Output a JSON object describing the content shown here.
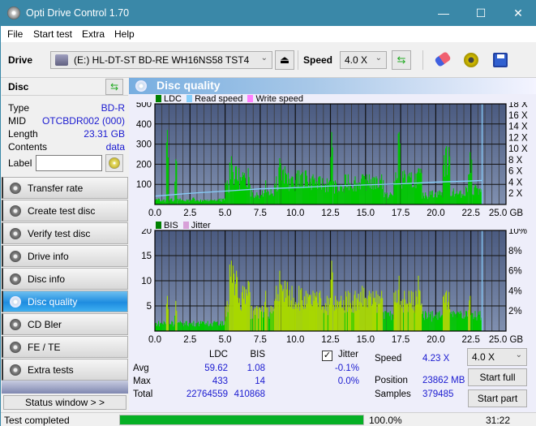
{
  "window": {
    "title": "Opti Drive Control 1.70",
    "minimize_glyph": "—",
    "maximize_glyph": "☐",
    "close_glyph": "✕"
  },
  "menu": [
    "File",
    "Start test",
    "Extra",
    "Help"
  ],
  "toolbar": {
    "drive_label": "Drive",
    "drive_value": "(E:)  HL-DT-ST BD-RE  WH16NS58 TST4",
    "speed_label": "Speed",
    "speed_value": "4.0 X",
    "icons": [
      "eject-icon",
      "refresh-icon",
      "erase-icon",
      "settings-icon",
      "save-icon"
    ]
  },
  "disc": {
    "heading": "Disc",
    "fields": [
      {
        "key": "Type",
        "value": "BD-R"
      },
      {
        "key": "MID",
        "value": "OTCBDR002 (000)"
      },
      {
        "key": "Length",
        "value": "23.31 GB"
      },
      {
        "key": "Contents",
        "value": "data"
      }
    ],
    "label_key": "Label",
    "label_value": ""
  },
  "nav": [
    {
      "label": "Transfer rate",
      "active": false
    },
    {
      "label": "Create test disc",
      "active": false
    },
    {
      "label": "Verify test disc",
      "active": false
    },
    {
      "label": "Drive info",
      "active": false
    },
    {
      "label": "Disc info",
      "active": false
    },
    {
      "label": "Disc quality",
      "active": true
    },
    {
      "label": "CD Bler",
      "active": false
    },
    {
      "label": "FE / TE",
      "active": false
    },
    {
      "label": "Extra tests",
      "active": false
    }
  ],
  "status_window_label": "Status window > >",
  "panel_title": "Disc quality",
  "colors": {
    "ldc": "#008000",
    "read_speed": "#87cefa",
    "write_speed": "#ff80ff",
    "bis": "#008000",
    "jitter": "#d8a0d8",
    "plot_bg_top": "#4a5a80",
    "plot_bg_bottom": "#8090b0",
    "bar_green": "#00c800",
    "bar_yellow": "#a8d800",
    "progress": "#06b025"
  },
  "chart_data": [
    {
      "type": "bar",
      "title": "LDC / Read speed",
      "legend": [
        "LDC",
        "Read speed",
        "Write speed"
      ],
      "legend_position": "top-left",
      "xlabel": "GB",
      "xlim": [
        0,
        25
      ],
      "x_ticks": [
        "0.0",
        "2.5",
        "5.0",
        "7.5",
        "10.0",
        "12.5",
        "15.0",
        "17.5",
        "20.0",
        "22.5",
        "25.0 GB"
      ],
      "ylim_left": [
        0,
        500
      ],
      "y_ticks_left": [
        "100",
        "200",
        "300",
        "400",
        "500"
      ],
      "ylim_right": [
        0,
        18
      ],
      "y_ticks_right": [
        "2 X",
        "4 X",
        "6 X",
        "8 X",
        "10 X",
        "12 X",
        "14 X",
        "16 X",
        "18 X"
      ],
      "grid": true,
      "ldc_series": {
        "x": [
          0,
          0.5,
          0.8,
          1.0,
          1.4,
          1.6,
          2.0,
          2.5,
          3.0,
          3.5,
          4.0,
          4.5,
          4.9,
          5.0,
          5.3,
          5.6,
          6.0,
          6.5,
          6.8,
          7.0,
          7.5,
          7.8,
          8.0,
          8.5,
          8.8,
          9.0,
          9.5,
          10.0,
          10.5,
          11.0,
          11.5,
          12.0,
          12.5,
          12.7,
          13.0,
          13.5,
          14.0,
          14.5,
          15.0,
          15.5,
          16.0,
          16.3,
          16.5,
          17.0,
          17.3,
          17.5,
          18.0,
          18.5,
          19.0,
          19.5,
          20.0,
          20.5,
          21.0,
          21.5,
          22.0,
          22.3,
          22.6,
          23.0,
          23.3
        ],
        "values": [
          30,
          25,
          370,
          30,
          225,
          30,
          25,
          35,
          25,
          25,
          25,
          30,
          30,
          120,
          240,
          190,
          160,
          180,
          80,
          60,
          70,
          120,
          80,
          140,
          230,
          190,
          140,
          170,
          170,
          150,
          140,
          130,
          360,
          120,
          100,
          150,
          140,
          150,
          150,
          140,
          150,
          60,
          60,
          160,
          360,
          170,
          160,
          180,
          60,
          70,
          70,
          290,
          80,
          70,
          90,
          260,
          100,
          80,
          100
        ]
      },
      "read_speed_series": {
        "x": [
          0,
          2.5,
          5.0,
          7.5,
          10.0,
          12.5,
          15.0,
          17.5,
          20.0,
          22.5,
          23.3
        ],
        "values": [
          1.5,
          2.0,
          2.4,
          2.8,
          3.0,
          3.3,
          3.5,
          3.7,
          4.0,
          4.2,
          4.3
        ]
      }
    },
    {
      "type": "bar",
      "title": "BIS / Jitter",
      "legend": [
        "BIS",
        "Jitter"
      ],
      "legend_position": "top-left",
      "xlabel": "GB",
      "xlim": [
        0,
        25
      ],
      "x_ticks": [
        "0.0",
        "2.5",
        "5.0",
        "7.5",
        "10.0",
        "12.5",
        "15.0",
        "17.5",
        "20.0",
        "22.5",
        "25.0 GB"
      ],
      "ylim_left": [
        0,
        20
      ],
      "y_ticks_left": [
        "5",
        "10",
        "15",
        "20"
      ],
      "ylim_right": [
        0,
        10
      ],
      "y_ticks_right": [
        "2%",
        "4%",
        "6%",
        "8%",
        "10%"
      ],
      "grid": true,
      "bis_series": {
        "x": [
          0,
          0.5,
          0.8,
          1.0,
          1.4,
          1.6,
          2.0,
          2.5,
          3.0,
          3.5,
          4.0,
          4.5,
          4.9,
          5.0,
          5.3,
          5.6,
          6.0,
          6.5,
          6.8,
          7.0,
          7.5,
          7.8,
          8.0,
          8.5,
          8.8,
          9.0,
          9.5,
          10.0,
          10.5,
          11.0,
          11.5,
          12.0,
          12.5,
          12.7,
          13.0,
          13.5,
          14.0,
          14.5,
          15.0,
          15.5,
          16.0,
          16.3,
          16.5,
          17.0,
          17.3,
          17.5,
          18.0,
          18.5,
          19.0,
          19.5,
          20.0,
          20.5,
          21.0,
          21.5,
          22.0,
          22.3,
          22.6,
          23.0,
          23.3
        ],
        "values": [
          2,
          2,
          7,
          2,
          6,
          2,
          2,
          2,
          2,
          2,
          2,
          2,
          2,
          6,
          14,
          12,
          9,
          10,
          5,
          5,
          5,
          8,
          5,
          9,
          12,
          10,
          9,
          9,
          8,
          8,
          8,
          7,
          14,
          7,
          7,
          8,
          8,
          9,
          8,
          8,
          8,
          4,
          4,
          8,
          11,
          8,
          8,
          11,
          4,
          4,
          4,
          8,
          4,
          4,
          4,
          7,
          4,
          4,
          4
        ]
      }
    }
  ],
  "stats": {
    "col_ldc": "LDC",
    "col_bis": "BIS",
    "jitter_label": "Jitter",
    "jitter_checked": true,
    "rows": [
      {
        "label": "Avg",
        "ldc": "59.62",
        "bis": "1.08",
        "jitter": "-0.1%"
      },
      {
        "label": "Max",
        "ldc": "433",
        "bis": "14",
        "jitter": "0.0%"
      },
      {
        "label": "Total",
        "ldc": "22764559",
        "bis": "410868",
        "jitter": ""
      }
    ],
    "speed_label": "Speed",
    "speed_value": "4.23 X",
    "position_label": "Position",
    "position_value": "23862 MB",
    "samples_label": "Samples",
    "samples_value": "379485",
    "speed_select": "4.0 X",
    "start_full": "Start full",
    "start_part": "Start part"
  },
  "statusbar": {
    "text": "Test completed",
    "progress_percent": 100.0,
    "progress_label": "100.0%",
    "elapsed": "31:22"
  }
}
